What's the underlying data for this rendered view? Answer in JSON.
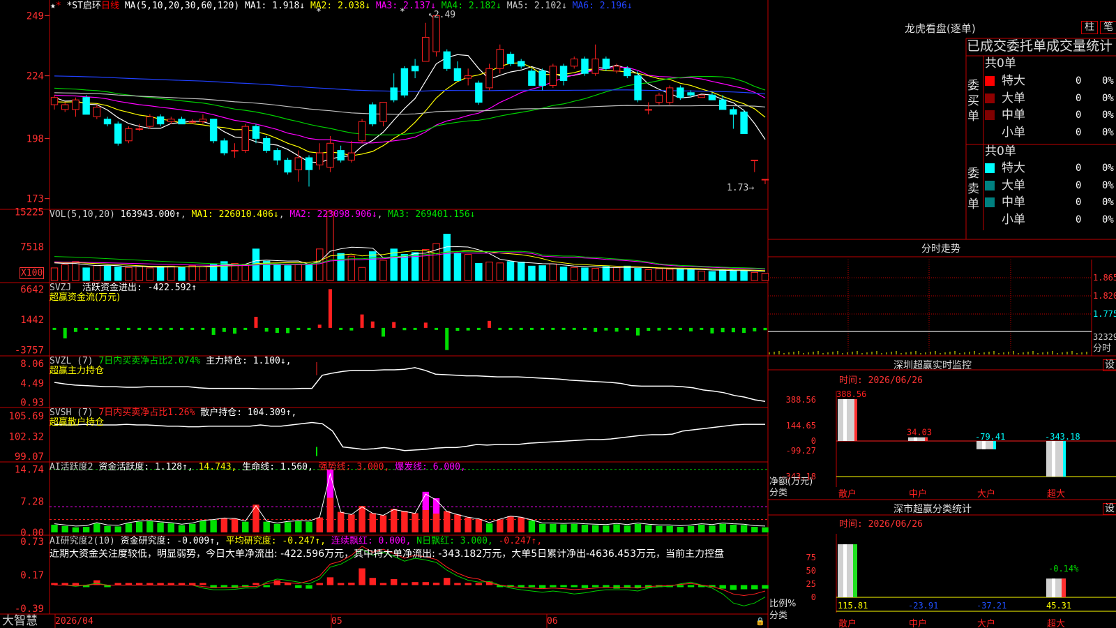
{
  "colors": {
    "up": "#ff2020",
    "down": "#00ffff",
    "grid": "#c00000",
    "axis": "#ff3030",
    "white": "#ffffff",
    "yellow": "#ffff00",
    "magenta": "#ff00ff",
    "green": "#00d000",
    "blue": "#2040ff",
    "gray": "#c0c0c0",
    "sell_mid": "#009090"
  },
  "brand": "大智慧",
  "dates": [
    "2026/04",
    "05",
    "06"
  ],
  "kline": {
    "title": "*ST启环",
    "period": "日线",
    "ma_header": "MA(5,10,20,30,60,120)",
    "ma_labels": [
      "MA1: 1.918↓",
      "MA2: 2.038↓",
      "MA3: 2.137↓",
      "MA4: 2.182↓",
      "MA5: 2.102↓",
      "MA6: 2.196↓"
    ],
    "y_ticks": [
      "249",
      "224",
      "198",
      "173"
    ],
    "max_label": "2.49",
    "min_label": "1.73",
    "markers": [
      "*",
      "*"
    ],
    "ylim": [
      1.7,
      2.52
    ],
    "candles": [
      [
        2.12,
        2.15,
        2.1,
        2.16
      ],
      [
        2.1,
        2.12,
        2.09,
        2.13
      ],
      [
        2.1,
        2.14,
        2.07,
        2.15
      ],
      [
        2.15,
        2.08,
        2.08,
        2.16
      ],
      [
        2.07,
        2.11,
        2.06,
        2.12
      ],
      [
        2.06,
        2.04,
        2.03,
        2.07
      ],
      [
        2.04,
        1.96,
        1.95,
        2.05
      ],
      [
        1.97,
        2.02,
        1.96,
        2.03
      ],
      [
        2.02,
        2.02,
        2.01,
        2.04
      ],
      [
        2.03,
        2.07,
        2.02,
        2.08
      ],
      [
        2.07,
        2.04,
        2.03,
        2.08
      ],
      [
        2.05,
        2.06,
        2.04,
        2.07
      ],
      [
        2.06,
        2.04,
        2.04,
        2.07
      ],
      [
        2.05,
        2.05,
        2.04,
        2.06
      ],
      [
        2.05,
        2.06,
        2.04,
        2.08
      ],
      [
        2.06,
        1.97,
        1.96,
        2.06
      ],
      [
        1.97,
        1.92,
        1.91,
        1.98
      ],
      [
        1.93,
        1.93,
        1.9,
        1.96
      ],
      [
        1.93,
        2.03,
        1.92,
        2.04
      ],
      [
        2.03,
        1.98,
        1.96,
        2.04
      ],
      [
        1.98,
        1.93,
        1.92,
        1.99
      ],
      [
        1.93,
        1.89,
        1.87,
        1.94
      ],
      [
        1.89,
        1.84,
        1.83,
        1.9
      ],
      [
        1.85,
        1.9,
        1.8,
        1.93
      ],
      [
        1.9,
        1.85,
        1.78,
        1.91
      ],
      [
        1.87,
        1.92,
        1.85,
        1.96
      ],
      [
        1.86,
        1.96,
        1.84,
        1.99
      ],
      [
        1.93,
        1.89,
        1.88,
        1.95
      ],
      [
        1.89,
        1.92,
        1.88,
        1.97
      ],
      [
        1.97,
        2.05,
        1.96,
        2.06
      ],
      [
        2.12,
        2.04,
        2.03,
        2.13
      ],
      [
        2.05,
        2.13,
        2.03,
        2.13
      ],
      [
        2.19,
        2.14,
        2.13,
        2.25
      ],
      [
        2.27,
        2.16,
        2.15,
        2.28
      ],
      [
        2.28,
        2.26,
        2.23,
        2.31
      ],
      [
        2.3,
        2.4,
        2.3,
        2.46
      ],
      [
        2.34,
        2.49,
        2.32,
        2.49
      ],
      [
        2.34,
        2.27,
        2.26,
        2.35
      ],
      [
        2.27,
        2.22,
        2.22,
        2.3
      ],
      [
        2.23,
        2.24,
        2.2,
        2.27
      ],
      [
        2.21,
        2.13,
        2.12,
        2.22
      ],
      [
        2.19,
        2.27,
        2.18,
        2.29
      ],
      [
        2.27,
        2.35,
        2.25,
        2.37
      ],
      [
        2.33,
        2.29,
        2.28,
        2.34
      ],
      [
        2.3,
        2.28,
        2.27,
        2.31
      ],
      [
        2.26,
        2.2,
        2.2,
        2.27
      ],
      [
        2.26,
        2.2,
        2.18,
        2.27
      ],
      [
        2.2,
        2.28,
        2.19,
        2.29
      ],
      [
        2.28,
        2.22,
        2.2,
        2.29
      ],
      [
        2.28,
        2.31,
        2.27,
        2.32
      ],
      [
        2.31,
        2.25,
        2.24,
        2.32
      ],
      [
        2.25,
        2.31,
        2.24,
        2.37
      ],
      [
        2.31,
        2.27,
        2.26,
        2.32
      ],
      [
        2.26,
        2.28,
        2.25,
        2.29
      ],
      [
        2.27,
        2.24,
        2.23,
        2.28
      ],
      [
        2.24,
        2.14,
        2.13,
        2.26
      ],
      [
        2.1,
        2.1,
        2.08,
        2.13
      ],
      [
        2.13,
        2.16,
        2.12,
        2.17
      ],
      [
        2.13,
        2.19,
        2.12,
        2.2
      ],
      [
        2.19,
        2.15,
        2.14,
        2.2
      ],
      [
        2.17,
        2.16,
        2.15,
        2.18
      ],
      [
        2.15,
        2.16,
        2.15,
        2.16
      ],
      [
        2.16,
        2.14,
        2.14,
        2.17
      ],
      [
        2.14,
        2.1,
        2.1,
        2.16
      ],
      [
        2.1,
        2.08,
        2.02,
        2.11
      ],
      [
        2.09,
        2.0,
        2.0,
        2.1
      ],
      [
        1.89,
        1.89,
        1.84,
        1.89
      ],
      [
        1.81,
        1.81,
        1.79,
        1.81
      ]
    ]
  },
  "vol": {
    "title": "VOL(5,10,20)",
    "value": "163943.000↑",
    "ma_labels": [
      "MA1: 226010.406↓",
      "MA2: 223098.906↓",
      "MA3: 269401.156↓"
    ],
    "y_ticks": [
      "15225",
      "7518"
    ],
    "unit": "X100",
    "ylim": [
      0,
      15800
    ],
    "values": [
      2800,
      3500,
      4200,
      2800,
      3300,
      3200,
      3000,
      2900,
      3100,
      2800,
      3000,
      3200,
      2900,
      3300,
      3100,
      3600,
      4200,
      3800,
      3400,
      7000,
      4300,
      3600,
      3300,
      3500,
      3400,
      7000,
      15225,
      6000,
      5400,
      2900,
      6400,
      4500,
      7000,
      5800,
      6200,
      6900,
      8200,
      10300,
      6000,
      5800,
      3800,
      4100,
      3900,
      4200,
      4100,
      3200,
      3300,
      3700,
      3000,
      2900,
      2800,
      2700,
      3100,
      2900,
      3200,
      2700,
      2400,
      2600,
      2500,
      2600,
      2400,
      2100,
      2000,
      2300,
      2300,
      2300,
      1800,
      1600
    ]
  },
  "svzj": {
    "title": "SVZJ",
    "label": "活跃资金进出: -422.592↑",
    "sub": "超赢资金流(万元)",
    "y_ticks": [
      "6642",
      "1442",
      "-3757"
    ],
    "ylim": [
      -4200,
      7400
    ],
    "values": [
      -250,
      -1800,
      -700,
      -300,
      -150,
      -300,
      -200,
      -200,
      -150,
      -150,
      -150,
      -150,
      -150,
      -150,
      -200,
      -1200,
      -700,
      -1000,
      -300,
      1900,
      -650,
      -850,
      -900,
      -350,
      -250,
      550,
      6642,
      -200,
      -450,
      2300,
      1100,
      -1500,
      1000,
      -400,
      -350,
      900,
      -350,
      -3800,
      -500,
      -450,
      -300,
      1200,
      -350,
      -250,
      -300,
      -300,
      -250,
      -250,
      -350,
      -300,
      -300,
      -700,
      -450,
      -650,
      -400,
      -1300,
      -500,
      -450,
      -250,
      -300,
      -600,
      -200,
      -950,
      -750,
      -750,
      -850,
      -600,
      -400
    ]
  },
  "svzl": {
    "title": "SVZL (7)",
    "label1": "7日内买卖净占比2.074%",
    "label2": "主力持仓: 1.100↓,",
    "sub": "超赢主力持仓",
    "y_ticks": [
      "8.06",
      "4.49",
      "0.93"
    ],
    "ylim": [
      0.5,
      9.2
    ],
    "values": [
      4.6,
      4.3,
      4.1,
      4.0,
      3.9,
      3.8,
      3.8,
      3.7,
      3.7,
      3.8,
      3.8,
      3.8,
      3.8,
      3.8,
      3.6,
      3.5,
      3.5,
      3.5,
      3.5,
      3.5,
      3.4,
      3.4,
      3.4,
      3.4,
      3.5,
      3.5,
      5.9,
      6.3,
      6.6,
      6.8,
      6.8,
      6.8,
      6.9,
      6.9,
      7.0,
      7.3,
      6.8,
      6.1,
      6.0,
      5.9,
      5.8,
      5.8,
      5.7,
      5.6,
      5.6,
      5.6,
      5.5,
      5.4,
      5.3,
      5.2,
      5.0,
      4.9,
      4.8,
      4.7,
      4.6,
      4.4,
      4.0,
      3.9,
      3.9,
      3.9,
      3.9,
      3.8,
      3.6,
      3.2,
      3.0,
      2.7,
      2.2,
      1.9,
      1.4,
      1.1
    ]
  },
  "svsh": {
    "title": "SVSH (7)",
    "label1": "7日内买卖净占比1.26%",
    "label2": "散户持仓: 104.309↑,",
    "sub": "超赢散户持仓",
    "y_ticks": [
      "105.69",
      "102.32",
      "99.07"
    ],
    "ylim": [
      98.6,
      106.6
    ],
    "values": [
      104.3,
      104.2,
      104.2,
      104.3,
      104.2,
      104.2,
      104.2,
      104.3,
      104.2,
      104.2,
      104.1,
      104.0,
      104.0,
      103.9,
      103.9,
      104.0,
      104.0,
      104.0,
      104.0,
      104.0,
      104.2,
      104.0,
      104.0,
      104.2,
      104.4,
      104.6,
      104.4,
      103.2,
      100.6,
      100.4,
      100.2,
      100.3,
      100.5,
      100.3,
      100.0,
      100.1,
      100.2,
      100.4,
      100.5,
      100.5,
      100.7,
      101.0,
      100.9,
      101.0,
      101.0,
      101.0,
      101.2,
      101.3,
      101.4,
      101.5,
      101.6,
      101.7,
      101.8,
      101.8,
      101.9,
      102.1,
      102.3,
      102.5,
      102.6,
      102.6,
      102.7,
      103.2,
      103.4,
      103.6,
      103.8,
      104.0,
      104.2,
      104.3,
      104.3,
      104.3
    ]
  },
  "ai1": {
    "title": "AI活跃度2",
    "label1": "资金活跃度: 1.128↑,",
    "label2": "14.743,",
    "label3": "生命线: 1.560,",
    "label4": "强势线: 3.000,",
    "label5": "爆发线: 6.000,",
    "y_ticks": [
      "14.74",
      "7.28",
      "0.00"
    ],
    "ylim": [
      0,
      16
    ],
    "values": [
      1.8,
      1.5,
      1.2,
      1.3,
      2.1,
      1.5,
      1.4,
      2.1,
      2.5,
      2.6,
      2.3,
      2.1,
      1.7,
      2.0,
      2.7,
      2.9,
      3.3,
      3.2,
      2.5,
      6.5,
      2.5,
      2.0,
      2.4,
      2.6,
      2.5,
      3.5,
      14.74,
      4.8,
      4.2,
      6.2,
      4.5,
      4.0,
      5.5,
      5.0,
      4.5,
      9.5,
      8.0,
      5.0,
      4.2,
      3.5,
      3.1,
      2.1,
      3.0,
      3.8,
      3.5,
      2.8,
      2.0,
      2.0,
      1.9,
      2.0,
      1.8,
      1.7,
      1.6,
      1.9,
      1.6,
      2.0,
      1.7,
      1.5,
      1.5,
      1.3,
      1.5,
      1.8,
      1.6,
      2.0,
      1.8,
      1.7,
      1.3,
      1.2
    ]
  },
  "ai2": {
    "title": "AI研究度2(10)",
    "label1": "资金研究度: -0.009↑,",
    "label2": "平均研究度: -0.247↑,",
    "label3": "连续飘红: 0.000,",
    "label4": "N日飘红: 3.000,",
    "label5": "-0.247↑,",
    "text": "近期大资金关注度较低，明显弱势，今日大单净流出: -422.596万元，其中特大单净流出: -343.182万元，大单5日累计净出-4636.453万元，当前主力控盘",
    "y_ticks": [
      "0.73",
      "0.17",
      "-0.39"
    ],
    "ylim": [
      -0.45,
      0.8
    ],
    "values": [
      0.0,
      0.0,
      0.0,
      -0.02,
      0.08,
      -0.03,
      0.03,
      0.02,
      0.02,
      0.02,
      0.03,
      0.03,
      0.02,
      0.03,
      0.02,
      -0.05,
      -0.03,
      -0.05,
      -0.02,
      0.02,
      -0.02,
      0.08,
      0.0,
      -0.05,
      -0.06,
      0.03,
      0.13,
      0.02,
      0.04,
      0.28,
      0.12,
      0.03,
      0.1,
      0.03,
      0.05,
      0.05,
      0.04,
      0.12,
      0.02,
      0.03,
      0.02,
      0.06,
      -0.03,
      -0.03,
      -0.02,
      -0.02,
      -0.05,
      -0.03,
      -0.02,
      -0.03,
      -0.05,
      -0.03,
      -0.02,
      -0.06,
      -0.05,
      -0.05,
      -0.05,
      -0.03,
      -0.02,
      -0.02,
      -0.02,
      -0.02,
      -0.03,
      -0.06,
      -0.08,
      -0.07,
      -0.07,
      -0.06
    ]
  },
  "lhb": {
    "title": "龙虎看盘(逐单)",
    "btn1": "柱",
    "btn2": "笔",
    "tabs": "已成交委托单成交量统计",
    "buy_header": "共0单",
    "buy_side": "委买单",
    "sell_header": "共0单",
    "sell_side": "委卖单",
    "rows": [
      {
        "name": "特大",
        "val": "0",
        "pct": "0%"
      },
      {
        "name": "大单",
        "val": "0",
        "pct": "0%"
      },
      {
        "name": "中单",
        "val": "0",
        "pct": "0%"
      },
      {
        "name": "小单",
        "val": "0",
        "pct": "0%"
      }
    ]
  },
  "fenshi": {
    "title": "分时走势",
    "y_ticks": [
      "1.865",
      "1.820",
      "1.775"
    ],
    "vol_tick": "32329",
    "vol_label": "分时"
  },
  "sz_monitor": {
    "title": "深圳超赢实时监控",
    "btn": "设",
    "time": "时间: 2026/06/26",
    "y_ticks": [
      "388.56",
      "144.65",
      "0",
      "-99.27",
      "-343.18"
    ],
    "ylabel": "净额(万元)",
    "xlabel": "分类",
    "cats": [
      "散户",
      "中户",
      "大户",
      "超大"
    ],
    "values": [
      388.56,
      34.03,
      -79.41,
      -343.18
    ],
    "val_labels": [
      "388.56",
      "34.03",
      "-79.41",
      "-343.18"
    ]
  },
  "sz_class": {
    "title": "深市超赢分类统计",
    "btn": "设",
    "time": "时间: 2026/06/26",
    "y_ticks": [
      "75",
      "50",
      "25",
      "0"
    ],
    "ylabel": "比例%",
    "xlabel": "分类",
    "cats": [
      "散户",
      "中户",
      "大户",
      "超大"
    ],
    "values": [
      115.81,
      -23.91,
      -37.21,
      45.31
    ],
    "val_labels": [
      "115.81",
      "-23.91",
      "-37.21",
      "45.31"
    ],
    "extra": "-0.14%"
  }
}
